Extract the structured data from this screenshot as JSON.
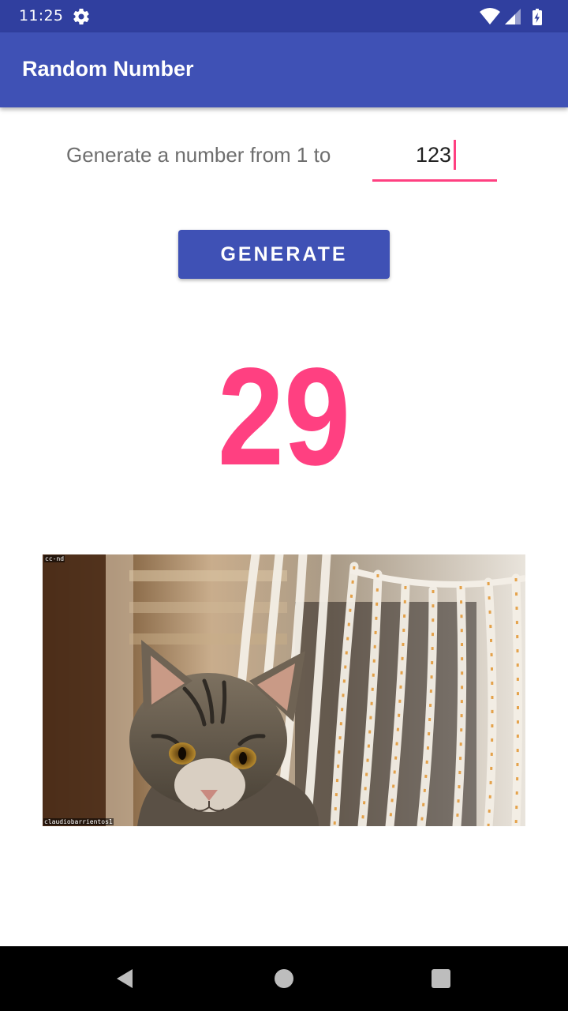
{
  "status_bar": {
    "time": "11:25",
    "icons": [
      "gear-icon",
      "wifi-icon",
      "cell-signal-icon",
      "battery-icon"
    ]
  },
  "app_bar": {
    "title": "Random Number",
    "color": "#3f51b5"
  },
  "form": {
    "prompt": "Generate a number from 1 to",
    "max_value": "123",
    "accent_color": "#ff4081"
  },
  "generate_button": {
    "label": "GENERATE"
  },
  "result": {
    "value": "29"
  },
  "image": {
    "subject": "tabby kitten beside white-and-orange rope fence",
    "watermark_top": "cc-nd",
    "watermark_bottom": "claudiobarrientos1"
  },
  "nav_bar": {
    "icons": [
      "back-icon",
      "home-icon",
      "recents-icon"
    ]
  }
}
